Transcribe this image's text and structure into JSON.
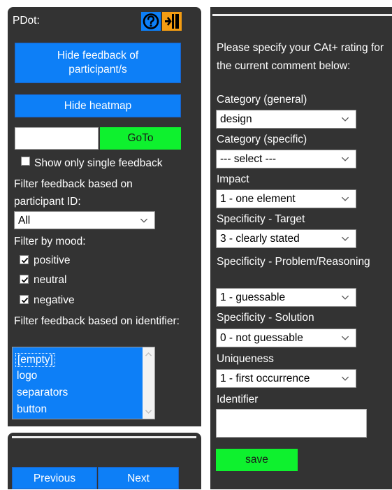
{
  "left": {
    "title": "PDot:",
    "hide_feedback_label": "Hide feedback of participant/s",
    "hide_heatmap_label": "Hide heatmap",
    "goto_value": "",
    "goto_label": "GoTo",
    "single_feedback_label": "Show only single feedback",
    "filter_participant_label": "Filter feedback based on participant ID:",
    "participant_select": "All",
    "filter_mood_label": "Filter by mood:",
    "moods": [
      {
        "label": "positive",
        "checked": true
      },
      {
        "label": "neutral",
        "checked": true
      },
      {
        "label": "negative",
        "checked": true
      }
    ],
    "filter_identifier_label": "Filter feedback based on identifier:",
    "identifiers": [
      "[empty]",
      "logo",
      "separators",
      "button"
    ]
  },
  "nav": {
    "previous_label": "Previous",
    "next_label": "Next"
  },
  "right": {
    "instruction": "Please specify your CAt+ rating for the current comment below:",
    "category_general_label": "Category (general)",
    "category_general_value": "design",
    "category_specific_label": "Category (specific)",
    "category_specific_value": "--- select ---",
    "impact_label": "Impact",
    "impact_value": "1 - one element",
    "target_label": "Specificity - Target",
    "target_value": "3 - clearly stated",
    "problem_label": "Specificity - Problem/Reasoning",
    "problem_value": "1 - guessable",
    "solution_label": "Specificity - Solution",
    "solution_value": "0 - not guessable",
    "uniqueness_label": "Uniqueness",
    "uniqueness_value": "1 - first occurrence",
    "identifier_label": "Identifier",
    "identifier_value": "",
    "save_label": "save"
  },
  "colors": {
    "panel": "#333333",
    "blue": "#0d7ff7",
    "green": "#0ef12e",
    "help_icon_bg": "#0d7ff7",
    "exit_icon_bg": "#f39c12"
  },
  "icons": [
    "help-icon",
    "exit-icon",
    "chevron-down-icon",
    "checkmark-icon"
  ]
}
